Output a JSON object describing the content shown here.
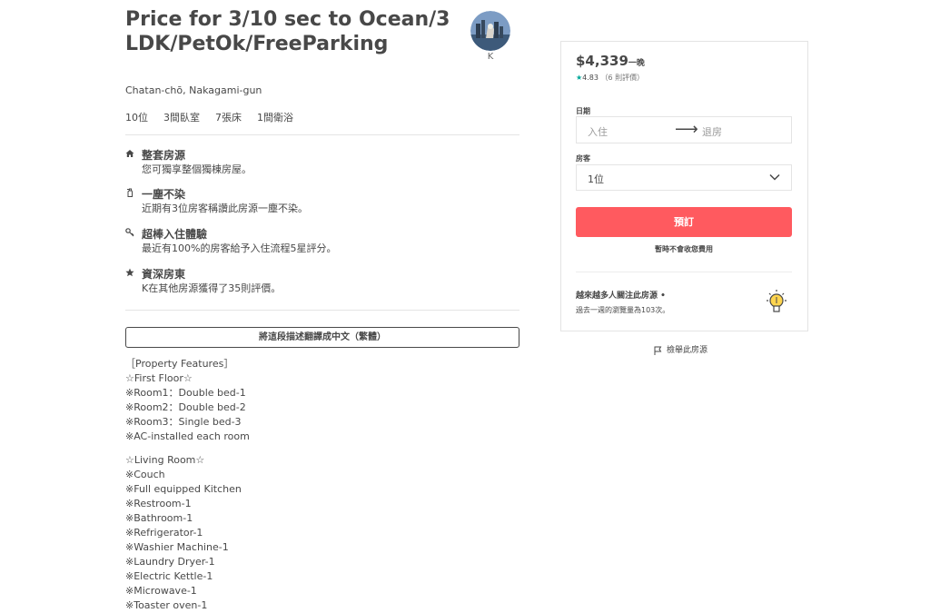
{
  "listing": {
    "title": "Price for 3/10 sec to Ocean/3LDK/PetOk/FreeParking",
    "location": "Chatan-chō, Nakagami-gun",
    "host_name": "K",
    "facts": [
      "10位",
      "3間臥室",
      "7張床",
      "1間衛浴"
    ]
  },
  "highlights": [
    {
      "icon": "home-icon",
      "title": "整套房源",
      "desc": "您可獨享整個獨棟房屋。"
    },
    {
      "icon": "spray-bottle-icon",
      "title": "一塵不染",
      "desc": "近期有3位房客稱讚此房源一塵不染。"
    },
    {
      "icon": "key-icon",
      "title": "超棒入住體驗",
      "desc": "最近有100%的房客給予入住流程5星評分。"
    },
    {
      "icon": "star-icon",
      "title": "資深房東",
      "desc": "K在其他房源獲得了35則評價。"
    }
  ],
  "translate_button": "將這段描述翻譯成中文（繁體）",
  "description": {
    "lines": [
      "［Property Features］",
      "☆First Floor☆",
      "※Room1：Double bed-1",
      "※Room2：Double bed-2",
      "※Room3：Single bed-3",
      "※AC-installed each room",
      "",
      "☆Living Room☆",
      "※Couch",
      "※Full equipped Kitchen",
      "※Restroom-1",
      "※Bathroom-1",
      "※Refrigerator-1",
      "※Washier Machine-1",
      "※Laundry Dryer-1",
      "※Electric Kettle-1",
      "※Microwave-1",
      "※Toaster oven-1"
    ]
  },
  "booking": {
    "price": "$4,339",
    "per_night": "一晚",
    "rating": "4.83",
    "reviews": "（6 則評價）",
    "dates_label": "日期",
    "checkin_placeholder": "入住",
    "checkout_placeholder": "退房",
    "guests_label": "房客",
    "guests_value": "1位",
    "reserve_button": "預訂",
    "note": "暫時不會收您費用",
    "popularity_title": "越來越多人關注此房源 •",
    "popularity_desc": "過去一週的瀏覽量為103次。",
    "report": "檢舉此房源"
  },
  "colors": {
    "reserve": "#ff5a5f",
    "rating_star": "#00a699",
    "text": "#484848"
  }
}
